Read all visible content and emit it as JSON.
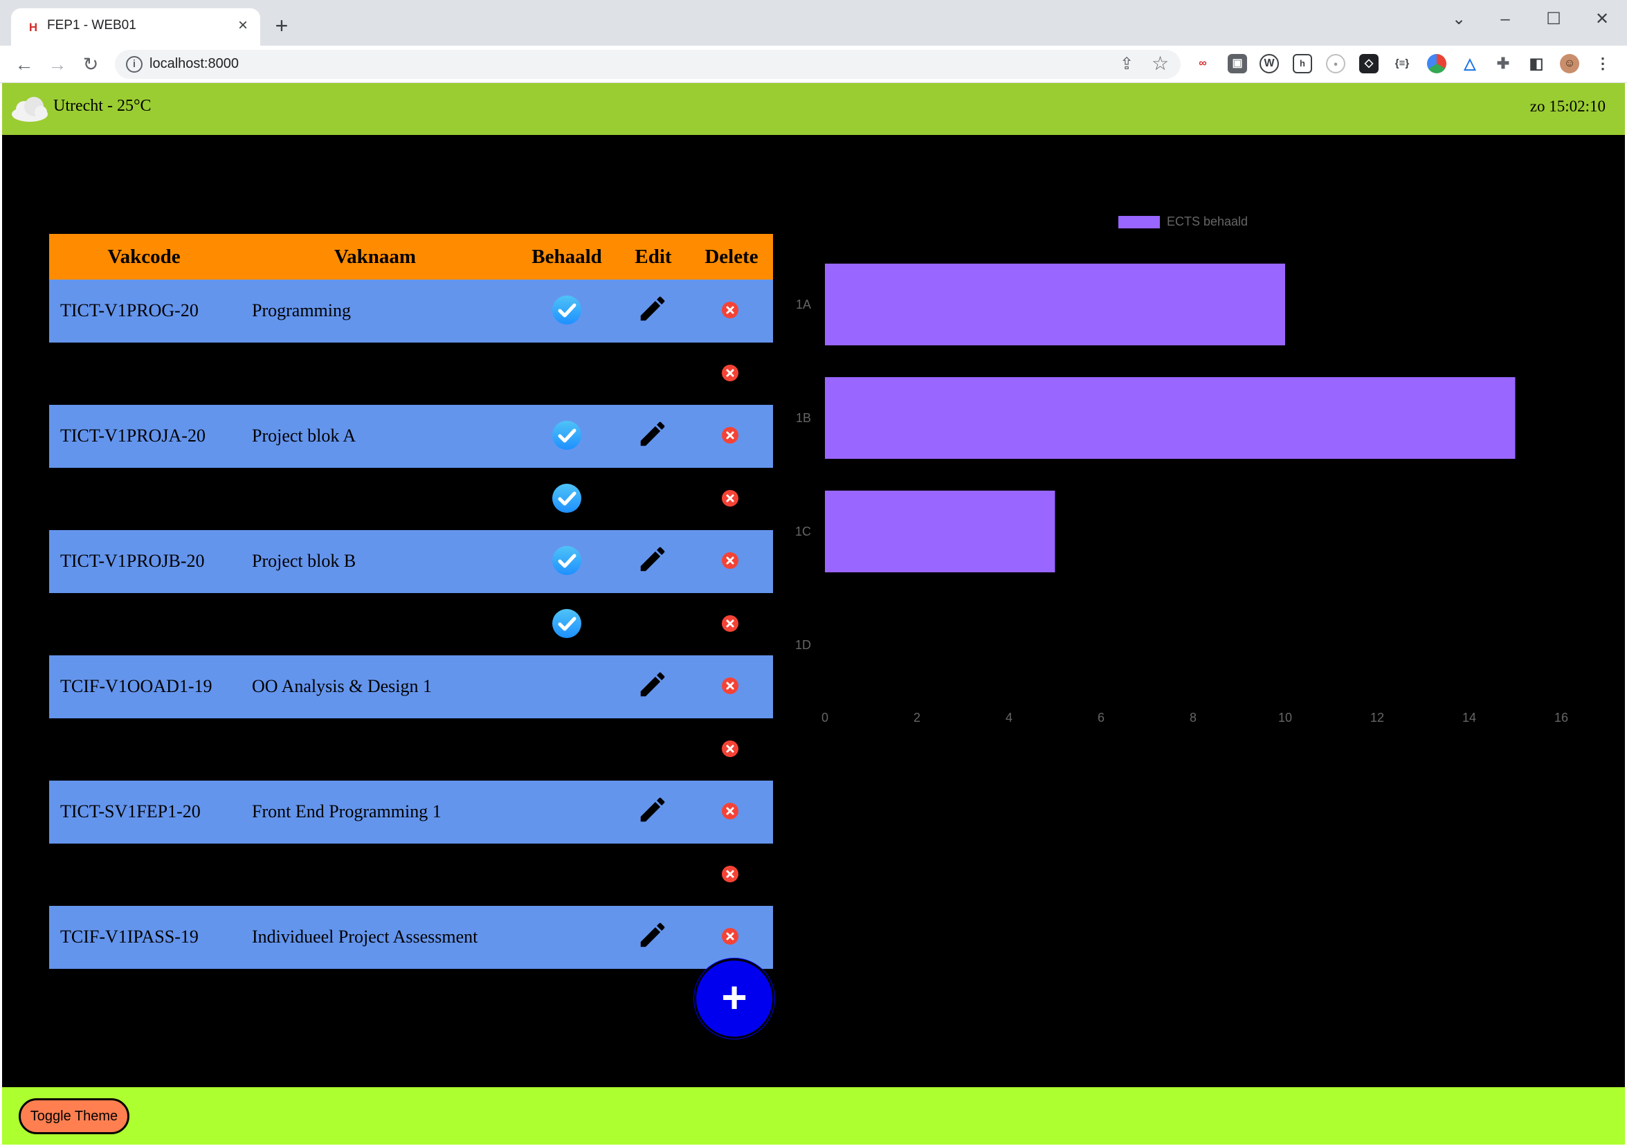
{
  "browser": {
    "tab_title": "FEP1 - WEB01",
    "favicon_text": "H",
    "url": "localhost:8000"
  },
  "header": {
    "weather": "Utrecht - 25°C",
    "clock": "zo 15:02:10"
  },
  "table": {
    "headers": {
      "code": "Vakcode",
      "name": "Vaknaam",
      "passed": "Behaald",
      "edit": "Edit",
      "delete": "Delete"
    },
    "rows": [
      {
        "code": "TICT-V1PROG-20",
        "name": "Programming",
        "passed": true,
        "editable": true,
        "filled": true
      },
      {
        "code": "",
        "name": "",
        "passed": false,
        "editable": false,
        "filled": false
      },
      {
        "code": "TICT-V1PROJA-20",
        "name": "Project blok A",
        "passed": true,
        "editable": true,
        "filled": true
      },
      {
        "code": "",
        "name": "",
        "passed": true,
        "editable": false,
        "filled": false
      },
      {
        "code": "TICT-V1PROJB-20",
        "name": "Project blok B",
        "passed": true,
        "editable": true,
        "filled": true
      },
      {
        "code": "",
        "name": "",
        "passed": true,
        "editable": false,
        "filled": false
      },
      {
        "code": "TCIF-V1OOAD1-19",
        "name": "OO Analysis & Design 1",
        "passed": false,
        "editable": true,
        "filled": true
      },
      {
        "code": "",
        "name": "",
        "passed": false,
        "editable": false,
        "filled": false
      },
      {
        "code": "TICT-SV1FEP1-20",
        "name": "Front End Programming 1",
        "passed": false,
        "editable": true,
        "filled": true
      },
      {
        "code": "",
        "name": "",
        "passed": false,
        "editable": false,
        "filled": false
      },
      {
        "code": "TCIF-V1IPASS-19",
        "name": "Individueel Project Assessment",
        "passed": false,
        "editable": true,
        "filled": true
      }
    ]
  },
  "add_button_label": "+",
  "footer": {
    "toggle_label": "Toggle Theme"
  },
  "colors": {
    "header_bg": "#9acd32",
    "footer_bg": "#adff2f",
    "table_head": "#ff8c00",
    "row_fill": "#6495ed",
    "bar": "#9966ff",
    "check": "#1e90ff",
    "delete": "#f44336",
    "add_button": "#0000ee",
    "toggle_button": "#ff7f50"
  },
  "chart_data": {
    "type": "bar",
    "orientation": "horizontal",
    "categories": [
      "1A",
      "1B",
      "1C",
      "1D"
    ],
    "series": [
      {
        "name": "ECTS behaald",
        "values": [
          10,
          15,
          5,
          0
        ]
      }
    ],
    "xlim": [
      0,
      16
    ],
    "xticks": [
      0,
      2,
      4,
      6,
      8,
      10,
      12,
      14,
      16
    ],
    "legend": "top",
    "grid": false
  }
}
